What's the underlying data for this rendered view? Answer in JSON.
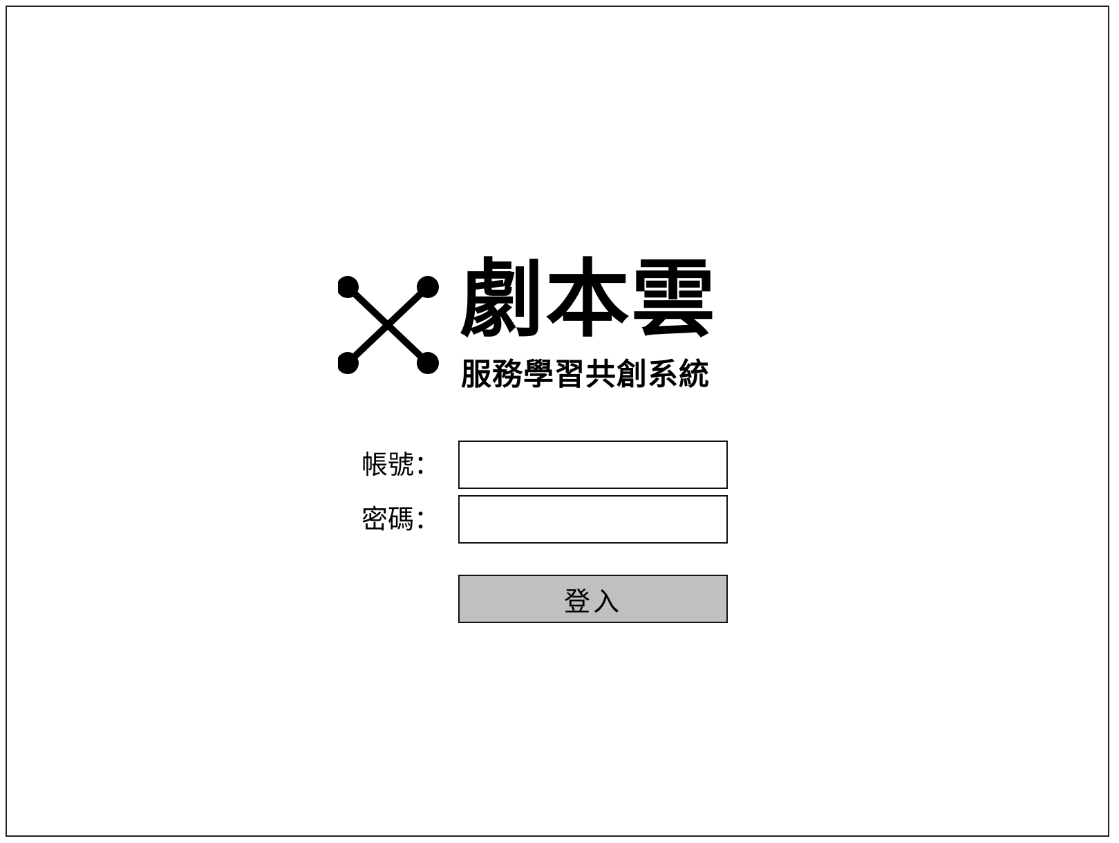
{
  "brand": {
    "title": "劇本雲",
    "subtitle": "服務學習共創系統",
    "logo_icon": "x-nodes-logo-icon"
  },
  "login_form": {
    "account_label": "帳號：",
    "account_value": "",
    "password_label": "密碼：",
    "password_value": "",
    "submit_label": "登入"
  },
  "colors": {
    "button_background": "#c0c0c0",
    "border": "#111111",
    "background": "#ffffff"
  }
}
